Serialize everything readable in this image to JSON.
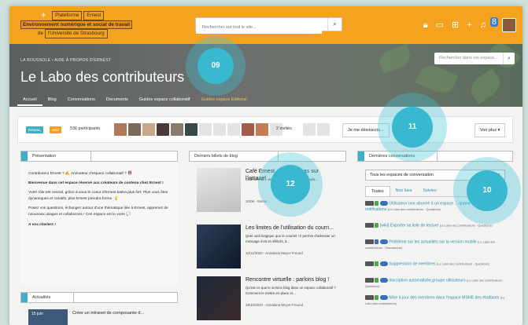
{
  "header": {
    "logo": {
      "line1": "Plateforme",
      "line1b": "Ernest",
      "line2": "Environnement numérique et social de travail",
      "line3a": "de",
      "line3b": "l'Université de Strasbourg"
    },
    "search_placeholder": "Rechercher sur tout le site...",
    "notification_count": "8"
  },
  "banner": {
    "breadcrumb": "LA BOUSSOLE › AIDE À PROPOS D'ERNEST",
    "title": "Le Labo des contributeurs",
    "search_placeholder": "Rechercher dans cet espace...",
    "tabs": [
      "Accueil",
      "Blog",
      "Conversations",
      "Documents",
      "Guides espace collaboratif",
      "Guides espace Editorial"
    ]
  },
  "participants": {
    "pill1": "Réseau",
    "pill2": "Actif",
    "count": "536 participants",
    "invites": "2 invités",
    "unsubscribe": "Je me désinscris...",
    "more": "Voir plus ▾"
  },
  "presentation": {
    "heading": "Présentation",
    "p1": "Contributeur Ernest ? ✍ Animateur d'espace collaboratif ? 👭",
    "p2": "Bienvenue dans cet espace réservé aux créateurs de contenu chez Ernest !",
    "p3": "Votre rôle est central, grâce à vous le coeur d'Ernest battra plus fort. Plus vous êtes dynamiques et créatifs, plus Ernest prendra forme. 💡",
    "p4": "Posez vos questions, échangez autour d'une thématique liée à Ernest, apprenez de nouveaux usages et collaborons ! Ces espace est le votre 💬",
    "p5": "A vos claviers !"
  },
  "blog": {
    "heading": "Derniers billets de blog",
    "posts": [
      {
        "title": "Café Ernest, premiers pas sur l'intranet ...",
        "excerpt": "Café Ernest ... composante ... Intranet\" Repla...",
        "meta": "10/06 - Simon ..."
      },
      {
        "title": "Les limites de l'utilisation du courri...",
        "excerpt": "Quel outil magique que le courriel ! Il permet d'adresser un message écrit et réfléchi, à...",
        "meta": "10/11/2020 - Annalena Meyer-Freund"
      },
      {
        "title": "Rencontre virtuelle : parlons blog !",
        "excerpt": "Qu'est-ce que le service blog dans un espace collaboratif ? Comment le mettre en place et...",
        "meta": "19/10/2020 - Annalena Meyer-Freund"
      }
    ]
  },
  "conversations": {
    "heading": "Dernières conversations",
    "select_value": "Tous les espaces de conversation",
    "tabs": [
      "Toutes",
      "Non lues",
      "Suivies"
    ],
    "items": [
      {
        "title": "Utilisateur non abonné à un espace ... quand même des notifications",
        "source": "(Le Labo des contributeurs - Questions)"
      },
      {
        "title": "[wiki] Exporter sa liste de lecture",
        "source": "(Le Labo des contributeurs - Questions)"
      },
      {
        "title": "Problème sur les actualités sur la version mobile",
        "source": "(Le Labo des contributeurs - Discussions)"
      },
      {
        "title": "Suppression de membres",
        "source": "(Le Labo des contributeurs - Questions)"
      },
      {
        "title": "Inscription automatisée groupe utilisateurs",
        "source": "(Le Labo des contributeurs - Questions)"
      },
      {
        "title": "Mise à jour des membres dans l'espace MSHE des étudiants",
        "source": "(Le Labo des contributeurs)"
      }
    ]
  },
  "news": {
    "heading": "Actualités",
    "date": "15 juin",
    "title": "Créer un intranet de composante d..."
  },
  "callouts": {
    "c09": "09",
    "c11": "11",
    "c12": "12",
    "c10": "10"
  },
  "colors": {
    "orange": "#f5a21f",
    "teal": "#39b9cf",
    "link": "#2a8fb0"
  }
}
